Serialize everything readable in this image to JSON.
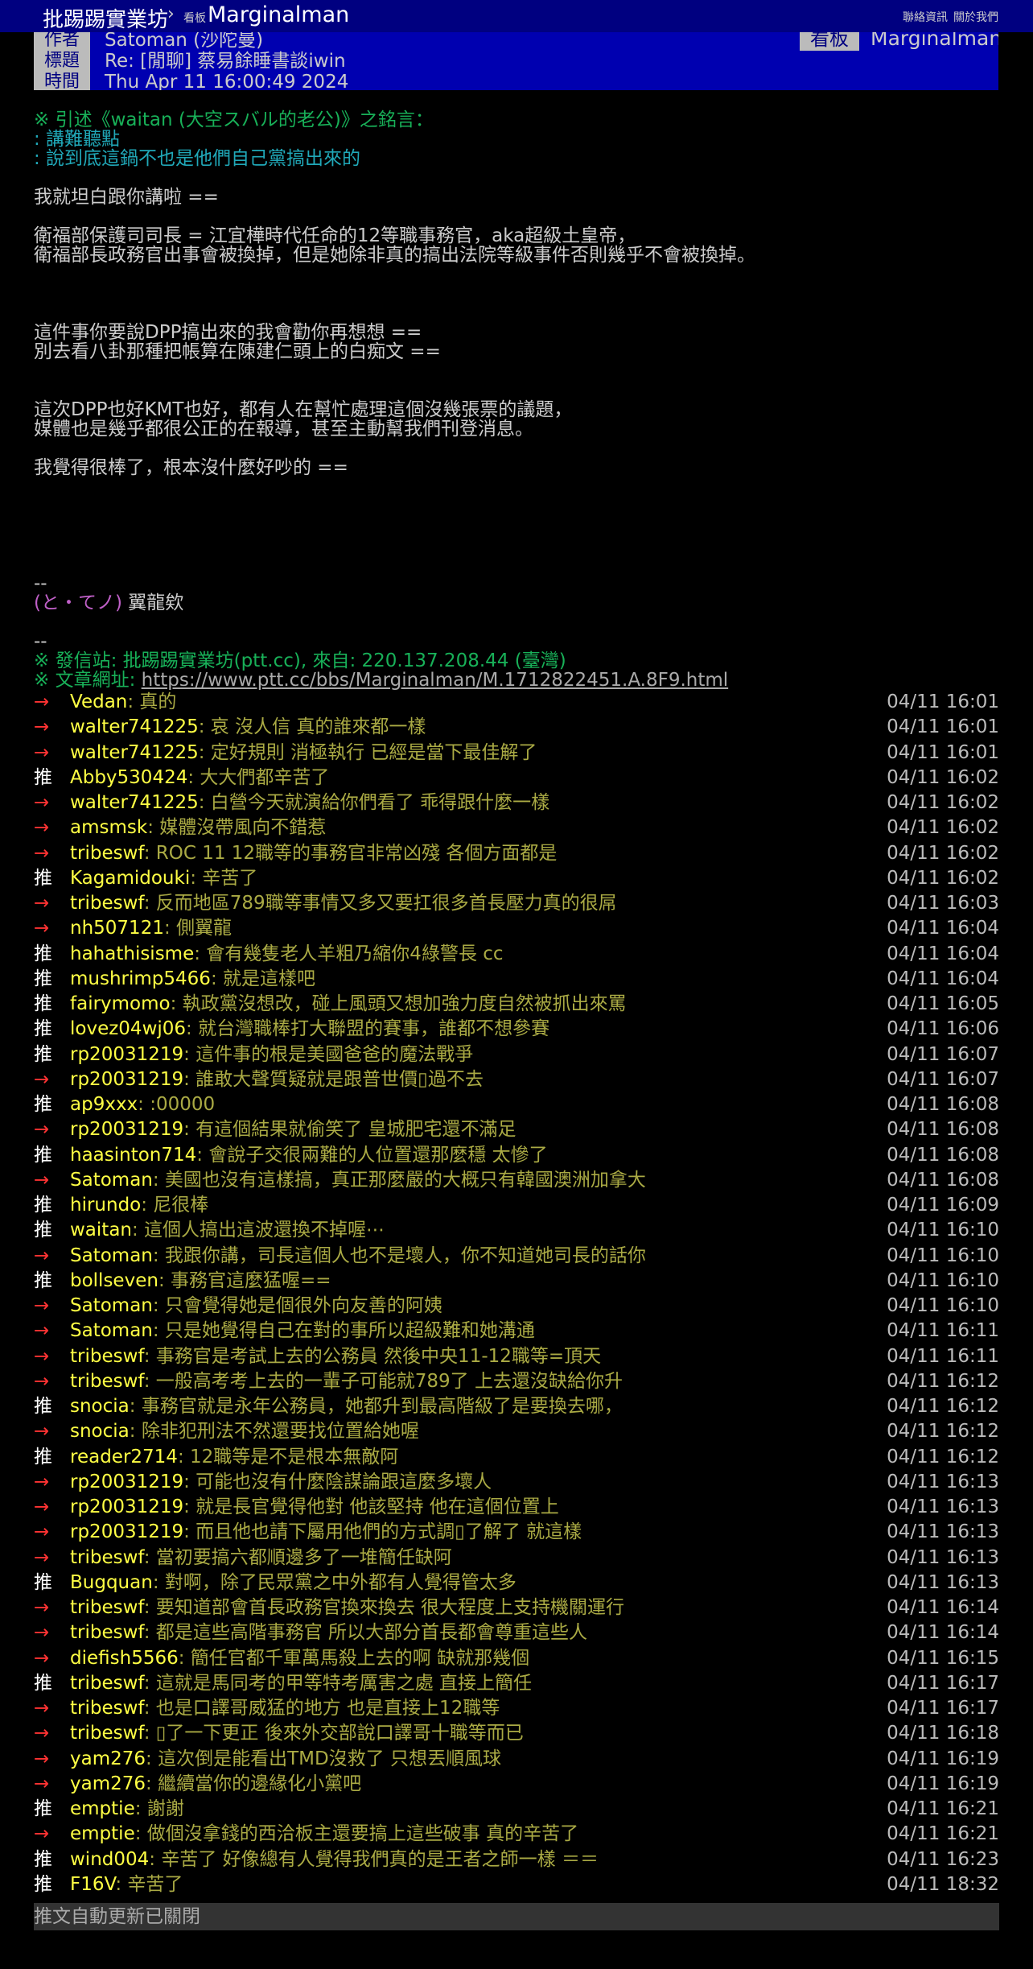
{
  "topbar": {
    "site": "批踢踢實業坊",
    "separator": "›",
    "board_tag": "看板",
    "board": "Marginalman",
    "link_contact": "聯絡資訊",
    "link_about": "關於我們"
  },
  "meta": {
    "author_label": "作者",
    "author_value": "Satoman (沙陀曼)",
    "title_label": "標題",
    "title_value": "Re: [閒聊] 蔡易餘睡書談iwin",
    "time_label": "時間",
    "time_value": "Thu Apr 11 16:00:49 2024",
    "board_label": "看板",
    "board_value": "Marginalman"
  },
  "article": {
    "quote_header": "※ 引述《waitan (大空スバル的老公)》之銘言：",
    "quote_line1": ": 講難聽點",
    "quote_line2": ": 說到底這鍋不也是他們自己黨搞出來的",
    "p1": "我就坦白跟你講啦 ==",
    "p2_l1": "衛福部保護司司長 = 江宜樺時代任命的12等職事務官，aka超級土皇帝，",
    "p2_l2": "衛福部長政務官出事會被換掉，但是她除非真的搞出法院等級事件否則幾乎不會被換掉。",
    "p3_l1": "這件事你要說DPP搞出來的我會勸你再想想 ==",
    "p3_l2": "別去看八卦那種把帳算在陳建仁頭上的白痴文 ==",
    "p4_l1": "這次DPP也好KMT也好，都有人在幫忙處理這個沒幾張票的議題，",
    "p4_l2": "媒體也是幾乎都很公正的在報導，甚至主動幫我們刊登消息。",
    "p5": "我覺得很棒了，根本沒什麼好吵的 ==",
    "sig_sep": "--",
    "sig_face": "(と・てノ)",
    "sig_text": " 翼龍欸",
    "sep2": "--",
    "origin": "※ 發信站: 批踢踢實業坊(ptt.cc), 來自: 220.137.208.44 (臺灣)",
    "url_label": "※ 文章網址: ",
    "url": "https://www.ptt.cc/bbs/Marginalman/M.1712822451.A.8F9.html"
  },
  "pushes": [
    {
      "tag": "→",
      "user": "Vedan",
      "text": ": 真的",
      "time": "04/11 16:01"
    },
    {
      "tag": "→",
      "user": "walter741225",
      "text": ": 哀 沒人信 真的誰來都一樣",
      "time": "04/11 16:01"
    },
    {
      "tag": "→",
      "user": "walter741225",
      "text": ": 定好規則 消極執行 已經是當下最佳解了",
      "time": "04/11 16:01"
    },
    {
      "tag": "推",
      "user": "Abby530424",
      "text": ": 大大們都辛苦了",
      "time": "04/11 16:02"
    },
    {
      "tag": "→",
      "user": "walter741225",
      "text": ": 白營今天就演給你們看了 乖得跟什麼一樣",
      "time": "04/11 16:02"
    },
    {
      "tag": "→",
      "user": "amsmsk",
      "text": ": 媒體沒帶風向不錯惹",
      "time": "04/11 16:02"
    },
    {
      "tag": "→",
      "user": "tribeswf",
      "text": ": ROC 11 12職等的事務官非常凶殘 各個方面都是",
      "time": "04/11 16:02"
    },
    {
      "tag": "推",
      "user": "Kagamidouki",
      "text": ": 辛苦了",
      "time": "04/11 16:02"
    },
    {
      "tag": "→",
      "user": "tribeswf",
      "text": ": 反而地區789職等事情又多又要扛很多首長壓力真的很屌",
      "time": "04/11 16:03"
    },
    {
      "tag": "→",
      "user": "nh507121",
      "text": ": 側翼龍",
      "time": "04/11 16:04"
    },
    {
      "tag": "推",
      "user": "hahathisisme",
      "text": ": 會有幾隻老人羊粗乃縮你4綠警長 cc",
      "time": "04/11 16:04"
    },
    {
      "tag": "推",
      "user": "mushrimp5466",
      "text": ": 就是這樣吧",
      "time": "04/11 16:04"
    },
    {
      "tag": "推",
      "user": "fairymomo",
      "text": ": 執政黨沒想改，碰上風頭又想加強力度自然被抓出來罵",
      "time": "04/11 16:05"
    },
    {
      "tag": "推",
      "user": "lovez04wj06",
      "text": ": 就台灣職棒打大聯盟的賽事，誰都不想參賽",
      "time": "04/11 16:06"
    },
    {
      "tag": "推",
      "user": "rp20031219",
      "text": ": 這件事的根是美國爸爸的魔法戰爭",
      "time": "04/11 16:07"
    },
    {
      "tag": "→",
      "user": "rp20031219",
      "text": ": 誰敢大聲質疑就是跟普世價▯過不去",
      "time": "04/11 16:07"
    },
    {
      "tag": "推",
      "user": "ap9xxx",
      "text": ": :00000",
      "time": "04/11 16:08"
    },
    {
      "tag": "→",
      "user": "rp20031219",
      "text": ": 有這個結果就偷笑了 皇城肥宅還不滿足",
      "time": "04/11 16:08"
    },
    {
      "tag": "推",
      "user": "haasinton714",
      "text": ": 會說子交很兩難的人位置還那麼穩 太慘了",
      "time": "04/11 16:08"
    },
    {
      "tag": "→",
      "user": "Satoman",
      "text": ": 美國也沒有這樣搞，真正那麼嚴的大概只有韓國澳洲加拿大",
      "time": "04/11 16:08"
    },
    {
      "tag": "推",
      "user": "hirundo",
      "text": ": 尼很棒",
      "time": "04/11 16:09"
    },
    {
      "tag": "推",
      "user": "waitan",
      "text": ": 這個人搞出這波還換不掉喔⋯",
      "time": "04/11 16:10"
    },
    {
      "tag": "→",
      "user": "Satoman",
      "text": ": 我跟你講，司長這個人也不是壞人，你不知道她司長的話你",
      "time": "04/11 16:10"
    },
    {
      "tag": "推",
      "user": "bollseven",
      "text": ": 事務官這麼猛喔==",
      "time": "04/11 16:10"
    },
    {
      "tag": "→",
      "user": "Satoman",
      "text": ": 只會覺得她是個很外向友善的阿姨",
      "time": "04/11 16:10"
    },
    {
      "tag": "→",
      "user": "Satoman",
      "text": ": 只是她覺得自己在對的事所以超級難和她溝通",
      "time": "04/11 16:11"
    },
    {
      "tag": "→",
      "user": "tribeswf",
      "text": ": 事務官是考試上去的公務員 然後中央11-12職等=頂天",
      "time": "04/11 16:11"
    },
    {
      "tag": "→",
      "user": "tribeswf",
      "text": ": 一般高考考上去的一輩子可能就789了 上去還沒缺給你升",
      "time": "04/11 16:12"
    },
    {
      "tag": "推",
      "user": "snocia",
      "text": ": 事務官就是永年公務員，她都升到最高階級了是要換去哪，",
      "time": "04/11 16:12"
    },
    {
      "tag": "→",
      "user": "snocia",
      "text": ": 除非犯刑法不然還要找位置給她喔",
      "time": "04/11 16:12"
    },
    {
      "tag": "推",
      "user": "reader2714",
      "text": ": 12職等是不是根本無敵阿",
      "time": "04/11 16:12"
    },
    {
      "tag": "→",
      "user": "rp20031219",
      "text": ": 可能也沒有什麼陰謀論跟這麼多壞人",
      "time": "04/11 16:13"
    },
    {
      "tag": "→",
      "user": "rp20031219",
      "text": ": 就是長官覺得他對 他該堅持 他在這個位置上",
      "time": "04/11 16:13"
    },
    {
      "tag": "→",
      "user": "rp20031219",
      "text": ": 而且他也請下屬用他們的方式調▯了解了 就這樣",
      "time": "04/11 16:13"
    },
    {
      "tag": "→",
      "user": "tribeswf",
      "text": ": 當初要搞六都順邊多了一堆簡任缺阿",
      "time": "04/11 16:13"
    },
    {
      "tag": "推",
      "user": "Bugquan",
      "text": ": 對啊，除了民眾黨之中外都有人覺得管太多",
      "time": "04/11 16:13"
    },
    {
      "tag": "→",
      "user": "tribeswf",
      "text": ": 要知道部會首長政務官換來換去 很大程度上支持機關運行",
      "time": "04/11 16:14"
    },
    {
      "tag": "→",
      "user": "tribeswf",
      "text": ": 都是這些高階事務官 所以大部分首長都會尊重這些人",
      "time": "04/11 16:14"
    },
    {
      "tag": "→",
      "user": "diefish5566",
      "text": ": 簡任官都千軍萬馬殺上去的啊 缺就那幾個",
      "time": "04/11 16:15"
    },
    {
      "tag": "推",
      "user": "tribeswf",
      "text": ": 這就是馬同考的甲等特考厲害之處 直接上簡任",
      "time": "04/11 16:17"
    },
    {
      "tag": "→",
      "user": "tribeswf",
      "text": ": 也是口譯哥威猛的地方 也是直接上12職等",
      "time": "04/11 16:17"
    },
    {
      "tag": "→",
      "user": "tribeswf",
      "text": ": ▯了一下更正 後來外交部說口譯哥十職等而已",
      "time": "04/11 16:18"
    },
    {
      "tag": "→",
      "user": "yam276",
      "text": ": 這次倒是能看出TMD沒救了 只想丟順風球",
      "time": "04/11 16:19"
    },
    {
      "tag": "→",
      "user": "yam276",
      "text": ": 繼續當你的邊緣化小黨吧",
      "time": "04/11 16:19"
    },
    {
      "tag": "推",
      "user": "emptie",
      "text": ": 謝謝",
      "time": "04/11 16:21"
    },
    {
      "tag": "→",
      "user": "emptie",
      "text": ": 做個沒拿錢的西洽板主還要搞上這些破事 真的辛苦了",
      "time": "04/11 16:21"
    },
    {
      "tag": "推",
      "user": "wind004",
      "text": ": 辛苦了 好像總有人覺得我們真的是王者之師一樣 ＝＝",
      "time": "04/11 16:23"
    },
    {
      "tag": "推",
      "user": "F16V",
      "text": ": 辛苦了",
      "time": "04/11 18:32"
    }
  ],
  "footer": {
    "text": "推文自動更新已關閉"
  }
}
